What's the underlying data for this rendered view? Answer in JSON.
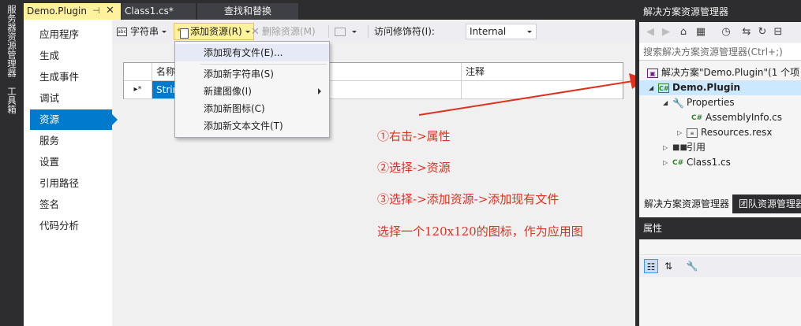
{
  "left_strip": {
    "tabs": [
      "服务器资源管理器",
      "工具箱"
    ]
  },
  "doc_tabs": {
    "active": "Demo.Plugin",
    "pin_glyph": "⊣",
    "close_glyph": "✕",
    "others": [
      "Class1.cs*",
      "查找和替换"
    ]
  },
  "project_tabs": [
    "应用程序",
    "生成",
    "生成事件",
    "调试",
    "资源",
    "服务",
    "设置",
    "引用路径",
    "签名",
    "代码分析"
  ],
  "resource_toolbar": {
    "strings_label": "字符串",
    "add_resource_label": "添加资源(R)",
    "remove_resource_label": "删除资源(M)",
    "access_modifier_label": "访问修饰符(I):",
    "access_modifier_value": "Internal"
  },
  "grid": {
    "headers": {
      "name": "名称",
      "comment": "注释"
    },
    "row": {
      "marker": "▸*",
      "name": "Strin"
    }
  },
  "add_resource_menu": [
    {
      "label": "添加现有文件(E)..."
    },
    {
      "label": "添加新字符串(S)"
    },
    {
      "label": "新建图像(I)",
      "submenu": true
    },
    {
      "label": "添加新图标(C)"
    },
    {
      "label": "添加新文本文件(T)"
    }
  ],
  "annotations": [
    "①右击->属性",
    "②选择->资源",
    "③选择->添加资源->添加现有文件",
    "选择一个120x120的图标，作为应用图"
  ],
  "solution_explorer": {
    "title": "解决方案资源管理器",
    "search_placeholder": "搜索解决方案资源管理器(Ctrl+;)",
    "tree": {
      "solution": "解决方案\"Demo.Plugin\"(1 个项",
      "project": "Demo.Plugin",
      "properties": "Properties",
      "assembly_info": "AssemblyInfo.cs",
      "resources": "Resources.resx",
      "references": "引用",
      "class1": "Class1.cs"
    },
    "bottom_tabs": [
      "解决方案资源管理器",
      "团队资源管理器"
    ]
  },
  "properties_panel": {
    "title": "属性"
  },
  "colors": {
    "accent": "#007acc",
    "active_tab": "#fff29d",
    "annotation": "#e0301e"
  }
}
